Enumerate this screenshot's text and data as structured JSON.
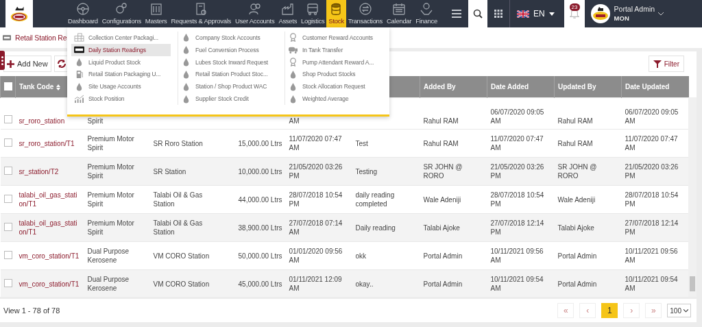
{
  "nav": {
    "items": [
      {
        "label": "Dashboard",
        "selected": false
      },
      {
        "label": "Configurations",
        "selected": false
      },
      {
        "label": "Masters",
        "selected": false
      },
      {
        "label": "Requests & Approvals",
        "selected": false
      },
      {
        "label": "User Accounts",
        "selected": false
      },
      {
        "label": "Assets",
        "selected": false
      },
      {
        "label": "Logistics",
        "selected": false
      },
      {
        "label": "Stock",
        "selected": true
      },
      {
        "label": "Transactions",
        "selected": false
      },
      {
        "label": "Calendar",
        "selected": false
      },
      {
        "label": "Finance",
        "selected": false
      }
    ],
    "language": "EN",
    "notifications": "23",
    "user": {
      "name": "Portal Admin",
      "role": "MON"
    }
  },
  "breadcrumb": "Retail Station Re",
  "stock_menu": {
    "columns": [
      [
        {
          "label": "Collection Center Packagi...",
          "kind": "pallet",
          "selected": false
        },
        {
          "label": "Daily Station Readings",
          "kind": "counter",
          "selected": true
        },
        {
          "label": "Liquid Product Stock",
          "kind": "drop",
          "selected": false
        },
        {
          "label": "Retail Station Packaging U...",
          "kind": "pump",
          "selected": false
        },
        {
          "label": "Site Usage Accounts",
          "kind": "drop",
          "selected": false
        },
        {
          "label": "Stock Position",
          "kind": "chart",
          "selected": false
        }
      ],
      [
        {
          "label": "Company Stock Accounts",
          "kind": "drop",
          "selected": false
        },
        {
          "label": "Fuel Conversion Process",
          "kind": "drop",
          "selected": false
        },
        {
          "label": "Lubes Stock Inward Request",
          "kind": "drop",
          "selected": false
        },
        {
          "label": "Retail Station Product Stoc...",
          "kind": "drop",
          "selected": false
        },
        {
          "label": "Station / Shop Product WAC",
          "kind": "drop",
          "selected": false
        },
        {
          "label": "Supplier Stock Credit",
          "kind": "drop",
          "selected": false
        }
      ],
      [
        {
          "label": "Customer Reward Accounts",
          "kind": "award",
          "selected": false
        },
        {
          "label": "In Tank Transfer",
          "kind": "tanker",
          "selected": false
        },
        {
          "label": "Pump Attendant Reward A...",
          "kind": "award",
          "selected": false
        },
        {
          "label": "Shop Product Stocks",
          "kind": "drop",
          "selected": false
        },
        {
          "label": "Stock Allocation Request",
          "kind": "drop",
          "selected": false
        },
        {
          "label": "Weighted Average",
          "kind": "drop",
          "selected": false
        }
      ]
    ]
  },
  "toolbar": {
    "add_button": "Add New",
    "filter_button": "Filter"
  },
  "table": {
    "select_all_checked": false,
    "columns": [
      "Tank Code",
      null,
      null,
      null,
      null,
      null,
      "Added By",
      "Date Added",
      "Updated By",
      "Date Updated"
    ],
    "rows": [
      {
        "checked": false,
        "tank_code": "sr_roro_station",
        "column_2": "Spirit",
        "column_5": "AM",
        "added_by": "Rahul RAM",
        "date_added": "06/07/2020 09:05 AM",
        "updated_by": "Rahul RAM",
        "date_updated": "06/07/2020 09:05 AM"
      },
      {
        "checked": false,
        "tank_code": "sr_roro_station/T1",
        "column_2": "Premium Motor Spirit",
        "column_3": "SR Roro Station",
        "column_4": "15,000.00 Ltrs",
        "column_5": "11/07/2020 07:47 AM",
        "column_6": "Test",
        "added_by": "Rahul RAM",
        "date_added": "11/07/2020 07:47 AM",
        "updated_by": "Rahul RAM",
        "date_updated": "11/07/2020 07:47 AM"
      },
      {
        "checked": false,
        "tank_code": "sr_station/T2",
        "column_2": "Premium Motor Spirit",
        "column_3": "SR Station",
        "column_4": "10,000.00 Ltrs",
        "column_5": "21/05/2020 03:26 PM",
        "column_6": "Testing",
        "added_by": "SR JOHN @ RORO",
        "date_added": "21/05/2020 03:26 PM",
        "updated_by": "SR JOHN @ RORO",
        "date_updated": "21/05/2020 03:26 PM"
      },
      {
        "checked": false,
        "tank_code": "talabi_oil_gas_station/T1",
        "column_2": "Premium Motor Spirit",
        "column_3": "Talabi Oil & Gas Station",
        "column_4": "44,000.00 Ltrs",
        "column_5": "28/07/2018 10:54 PM",
        "column_6": "daily reading completed",
        "added_by": "Wale Adeniji",
        "date_added": "28/07/2018 10:54 PM",
        "updated_by": "Wale Adeniji",
        "date_updated": "28/07/2018 10:54 PM"
      },
      {
        "checked": false,
        "tank_code": "talabi_oil_gas_station/T1",
        "column_2": "Premium Motor Spirit",
        "column_3": "Talabi Oil & Gas Station",
        "column_4": "38,900.00 Ltrs",
        "column_5": "27/07/2018 07:14 AM",
        "column_6": "Daily reading",
        "added_by": "Talabi Ajoke",
        "date_added": "27/07/2018 12:14 PM",
        "updated_by": "Talabi Ajoke",
        "date_updated": "27/07/2018 12:14 PM"
      },
      {
        "checked": false,
        "tank_code": "vm_coro_station/T1",
        "column_2": "Dual Purpose Kerosene",
        "column_3": "VM CORO Station",
        "column_4": "50,000.00 Ltrs",
        "column_5": "01/01/2020 09:56 AM",
        "column_6": "okk",
        "added_by": "Portal Admin",
        "date_added": "10/11/2021 09:56 AM",
        "updated_by": "Portal Admin",
        "date_updated": "10/11/2021 09:56 AM"
      },
      {
        "checked": false,
        "tank_code": "vm_coro_station/T1",
        "column_2": "Dual Purpose Kerosene",
        "column_3": "VM CORO Station",
        "column_4": "45,000.00 Ltrs",
        "column_5": "01/11/2021 12:09 AM",
        "column_6": "okay..",
        "added_by": "Portal Admin",
        "date_added": "10/11/2021 09:54 AM",
        "updated_by": "Portal Admin",
        "date_updated": "10/11/2021 09:54 AM"
      }
    ]
  },
  "footer": {
    "record_info": "View 1 - 78 of 78",
    "pages": [
      {
        "label": "1",
        "selected": true
      }
    ],
    "first": "«",
    "prev": "‹",
    "next": "›",
    "last": "»",
    "page_size": "100"
  }
}
